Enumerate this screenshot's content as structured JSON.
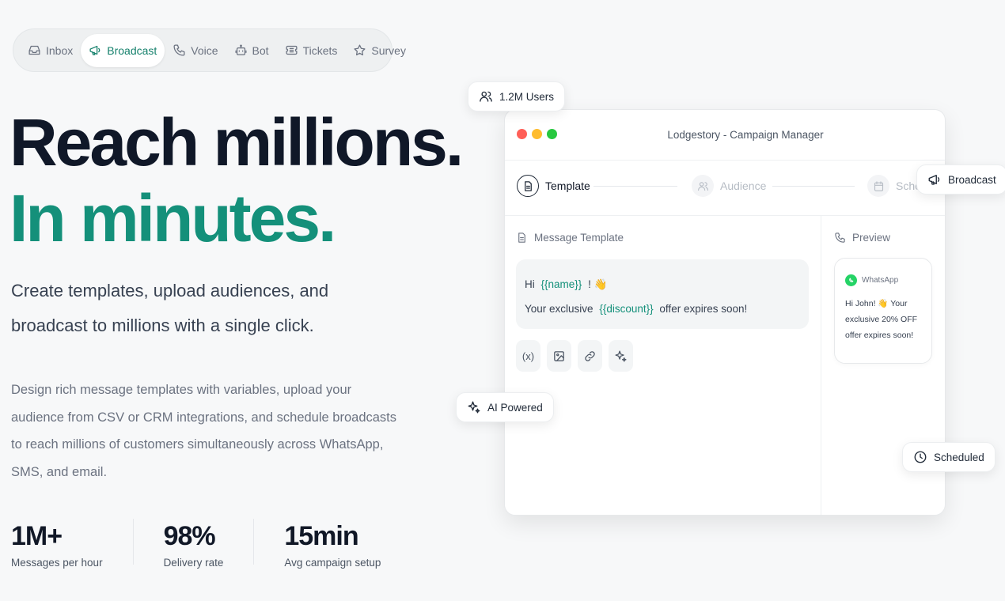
{
  "nav": {
    "items": [
      {
        "label": "Inbox",
        "icon": "inbox-icon",
        "active": false
      },
      {
        "label": "Broadcast",
        "icon": "megaphone-icon",
        "active": true
      },
      {
        "label": "Voice",
        "icon": "phone-icon",
        "active": false
      },
      {
        "label": "Bot",
        "icon": "bot-icon",
        "active": false
      },
      {
        "label": "Tickets",
        "icon": "ticket-icon",
        "active": false
      },
      {
        "label": "Survey",
        "icon": "star-icon",
        "active": false
      }
    ]
  },
  "hero": {
    "headline_line1": "Reach millions.",
    "headline_line2": "In minutes.",
    "lead": "Create templates, upload audiences, and broadcast to millions with a single click.",
    "description": "Design rich message templates with variables, upload your audience from CSV or CRM integrations, and schedule broadcasts to reach millions of customers simultaneously across WhatsApp, SMS, and email."
  },
  "stats": [
    {
      "value": "1M+",
      "label": "Messages per hour"
    },
    {
      "value": "98%",
      "label": "Delivery rate"
    },
    {
      "value": "15min",
      "label": "Avg campaign setup"
    }
  ],
  "chips": {
    "users": "1.2M Users",
    "broadcast": "Broadcast",
    "ai": "AI Powered",
    "scheduled": "Scheduled"
  },
  "window": {
    "title": "Lodgestory - Campaign Manager",
    "steps": [
      {
        "label": "Template",
        "state": "active"
      },
      {
        "label": "Audience",
        "state": "inactive"
      },
      {
        "label": "Sche",
        "state": "inactive"
      }
    ],
    "editor": {
      "heading": "Message Template",
      "line1_prefix": "Hi",
      "line1_var": "{{name}}",
      "line1_suffix": "! 👋",
      "line2_prefix": "Your exclusive",
      "line2_var": "{{discount}}",
      "line2_suffix": "offer expires soon!",
      "variable_tool": "(x)"
    },
    "preview": {
      "heading": "Preview",
      "channel": "WhatsApp",
      "message": "Hi John! 👋 Your exclusive 20% OFF offer expires soon!"
    }
  },
  "colors": {
    "accent": "#14907a",
    "headline": "#101828",
    "whatsapp": "#25d366",
    "dot_red": "#ff5f57",
    "dot_yellow": "#febc2e",
    "dot_green": "#28c840"
  }
}
